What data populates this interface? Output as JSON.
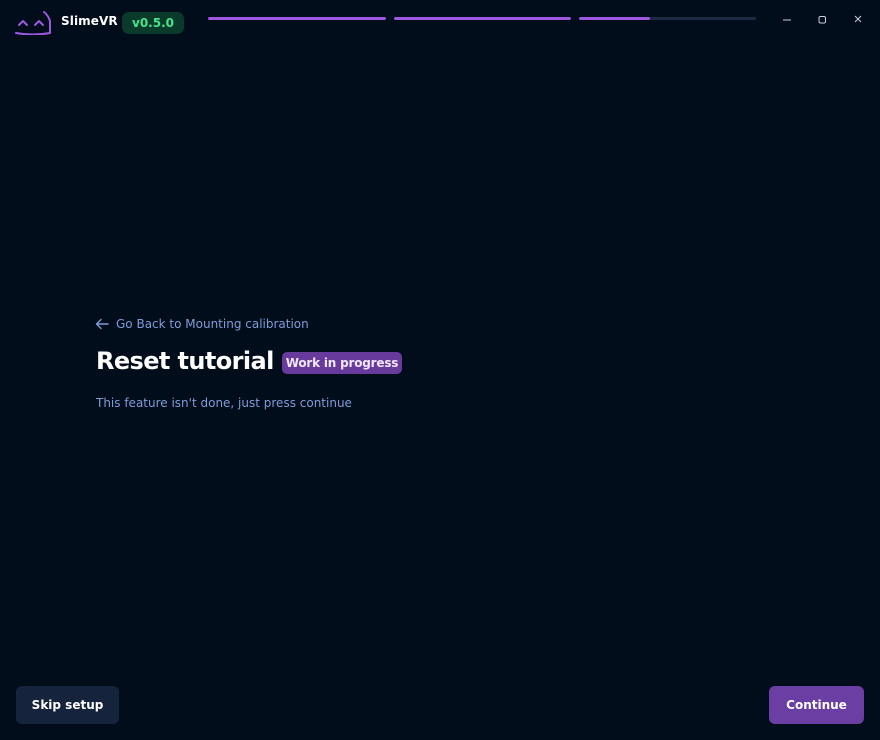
{
  "app": {
    "name": "SlimeVR",
    "version": "v0.5.0",
    "colors": {
      "background": "#020d1c",
      "accent": "#9e58e0",
      "version_text": "#46e58c",
      "muted_text": "#7d9dd8"
    }
  },
  "progress": [
    {
      "label": "step-1",
      "fraction": 1.0
    },
    {
      "label": "step-2",
      "fraction": 1.0
    },
    {
      "label": "step-3",
      "fraction": 0.4
    }
  ],
  "window_controls": {
    "minimize_icon": "minimize-icon",
    "maximize_icon": "maximize-icon",
    "close_icon": "close-icon"
  },
  "main": {
    "back_link": "Go Back to Mounting calibration",
    "title": "Reset tutorial",
    "badge": "Work in progress",
    "description": "This feature isn't done, just press continue"
  },
  "footer": {
    "skip_label": "Skip setup",
    "continue_label": "Continue"
  }
}
